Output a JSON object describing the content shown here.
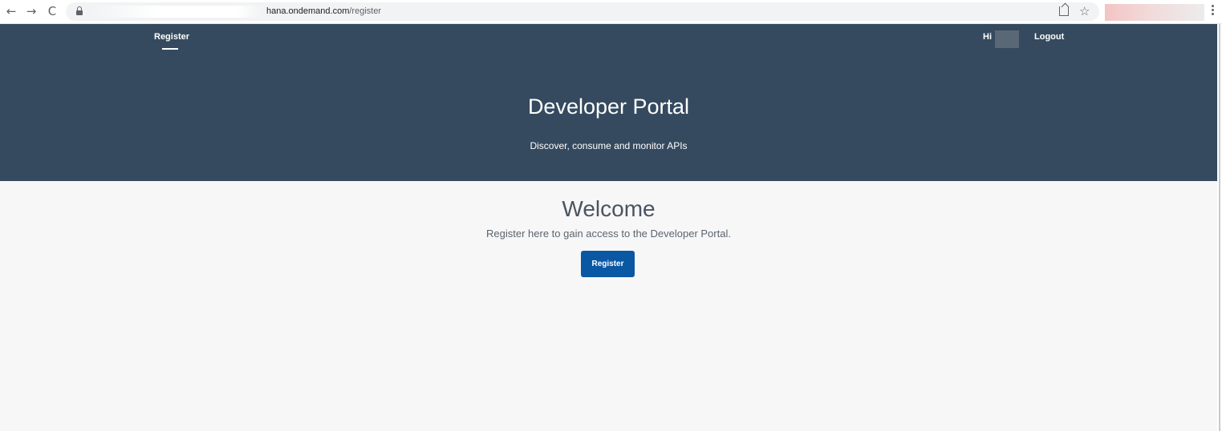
{
  "browser": {
    "url_host": "hana.ondemand.com",
    "url_path": "/register",
    "back_icon": "arrow-left",
    "forward_icon": "arrow-right",
    "reload_icon": "reload",
    "back_glyph": "←",
    "forward_glyph": "→",
    "reload_glyph": "C",
    "star_glyph": "☆"
  },
  "header": {
    "nav_tab": "Register",
    "greeting": "Hi",
    "logout": "Logout",
    "title": "Developer Portal",
    "subtitle": "Discover, consume and monitor APIs",
    "background_color": "#354a5f"
  },
  "main": {
    "welcome_title": "Welcome",
    "welcome_text": "Register here to gain access to the Developer Portal.",
    "register_button": "Register",
    "button_color": "#0a57a4"
  }
}
